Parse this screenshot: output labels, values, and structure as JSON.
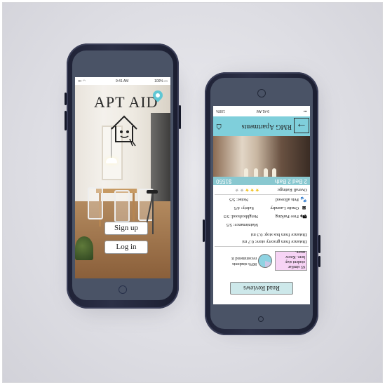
{
  "left_phone": {
    "status": {
      "time": "9:41 AM",
      "battery": "100%"
    },
    "app_title": "APT AID",
    "signup_label": "Sign up",
    "login_label": "Log in"
  },
  "right_phone": {
    "status": {
      "time": "9:41 AM",
      "battery": "100%"
    },
    "header": {
      "title": "RMG Apartments",
      "back_arrow": "→"
    },
    "listing": {
      "beds_baths": "2 Bed 2 Bath",
      "price": "$1550"
    },
    "overall_rating_label": "Overall Ratings:",
    "rating": {
      "filled": 3,
      "total": 5
    },
    "amenities": [
      {
        "label": "Pets allowed",
        "icon": "paw-icon"
      },
      {
        "label": "Onsite Laundry",
        "icon": "washer-icon"
      },
      {
        "label": "Free Parking",
        "icon": "car-icon"
      }
    ],
    "scores": [
      {
        "label": "Noise: 5/5"
      },
      {
        "label": "Safety: 4/5"
      },
      {
        "label": "Neighborhood: 5/5"
      },
      {
        "label": "Maintenance: 5/5"
      }
    ],
    "distances": [
      {
        "label": "Distance from bus stop: 0.3 mi"
      },
      {
        "label": "Distance from grocery store: 0.7 mi"
      }
    ],
    "similar_box": "65 similar student stay here. Know more.",
    "recommend_line1": "80% students",
    "recommend_line2": "recommend it",
    "recommend_fraction": 0.8,
    "reviews_button": "Read Reviews"
  }
}
